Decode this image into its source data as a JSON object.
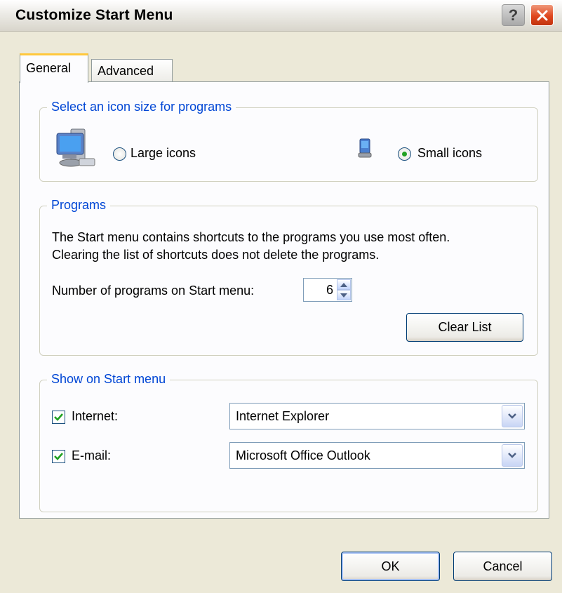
{
  "window": {
    "title": "Customize Start Menu",
    "help_label": "?"
  },
  "tabs": [
    {
      "label": "General",
      "selected": true
    },
    {
      "label": "Advanced",
      "selected": false
    }
  ],
  "icon_size": {
    "legend": "Select an icon size for programs",
    "large_label": "Large icons",
    "small_label": "Small icons",
    "selected": "small"
  },
  "programs": {
    "legend": "Programs",
    "description_line1": "The Start menu contains shortcuts to the programs you use most often.",
    "description_line2": "Clearing the list of shortcuts does not delete the programs.",
    "count_label": "Number of programs on Start menu:",
    "count_value": "6",
    "clear_button": "Clear List"
  },
  "show_on_start": {
    "legend": "Show on Start menu",
    "internet": {
      "label": "Internet:",
      "checked": true,
      "value": "Internet Explorer"
    },
    "email": {
      "label": "E-mail:",
      "checked": true,
      "value": "Microsoft Office Outlook"
    }
  },
  "buttons": {
    "ok": "OK",
    "cancel": "Cancel"
  },
  "colors": {
    "legend": "#0046d5",
    "tab_accent": "#ffc83c",
    "check": "#21a121",
    "close_button": "#e0471f"
  },
  "icons": {
    "large": "computer-large-icon",
    "small": "computer-small-icon",
    "close": "close-icon"
  }
}
